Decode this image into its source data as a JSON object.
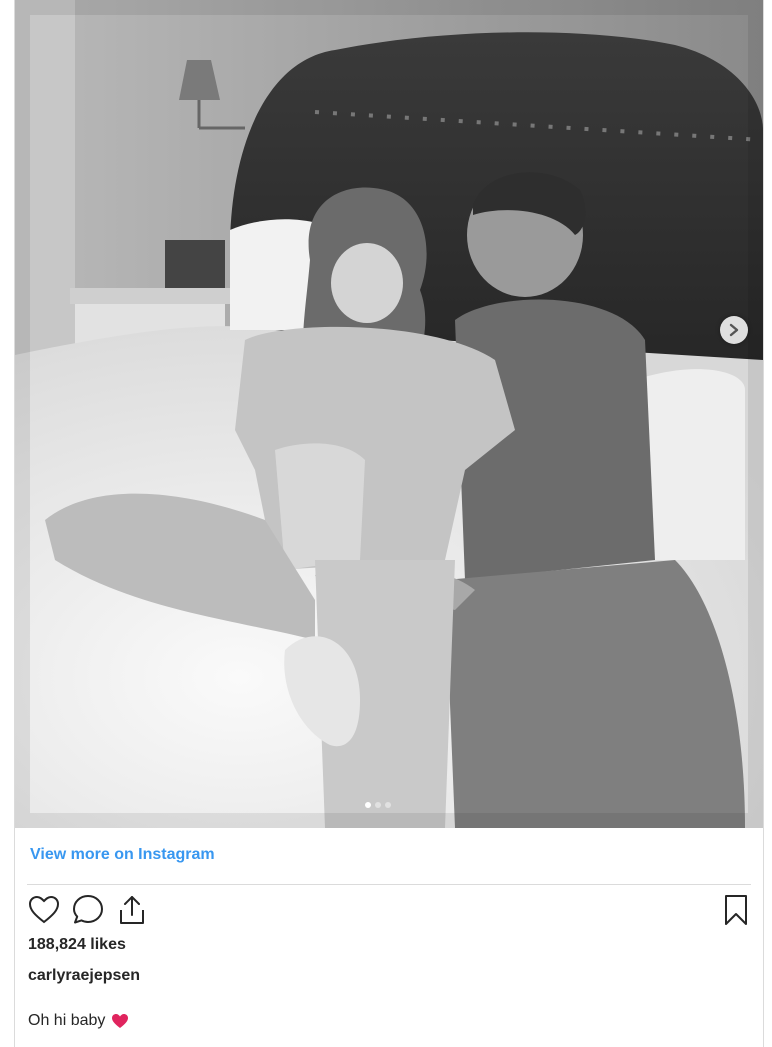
{
  "post": {
    "view_more_label": "View more on Instagram",
    "likes_text": "188,824 likes",
    "username": "carlyraejepsen",
    "caption_text": "Oh hi baby",
    "caption_emoji": "heart-emoji",
    "carousel_slides_total": 3,
    "carousel_active_index": 0,
    "photo_style": "black-and-white"
  },
  "colors": {
    "link_blue": "#3897f0",
    "text": "#262626",
    "divider": "#dbdbdb",
    "heart_red": "#e0245e"
  },
  "icons": {
    "like": "heart-outline-icon",
    "comment": "comment-bubble-icon",
    "share": "share-upload-icon",
    "save": "bookmark-icon",
    "next": "chevron-right-icon"
  }
}
